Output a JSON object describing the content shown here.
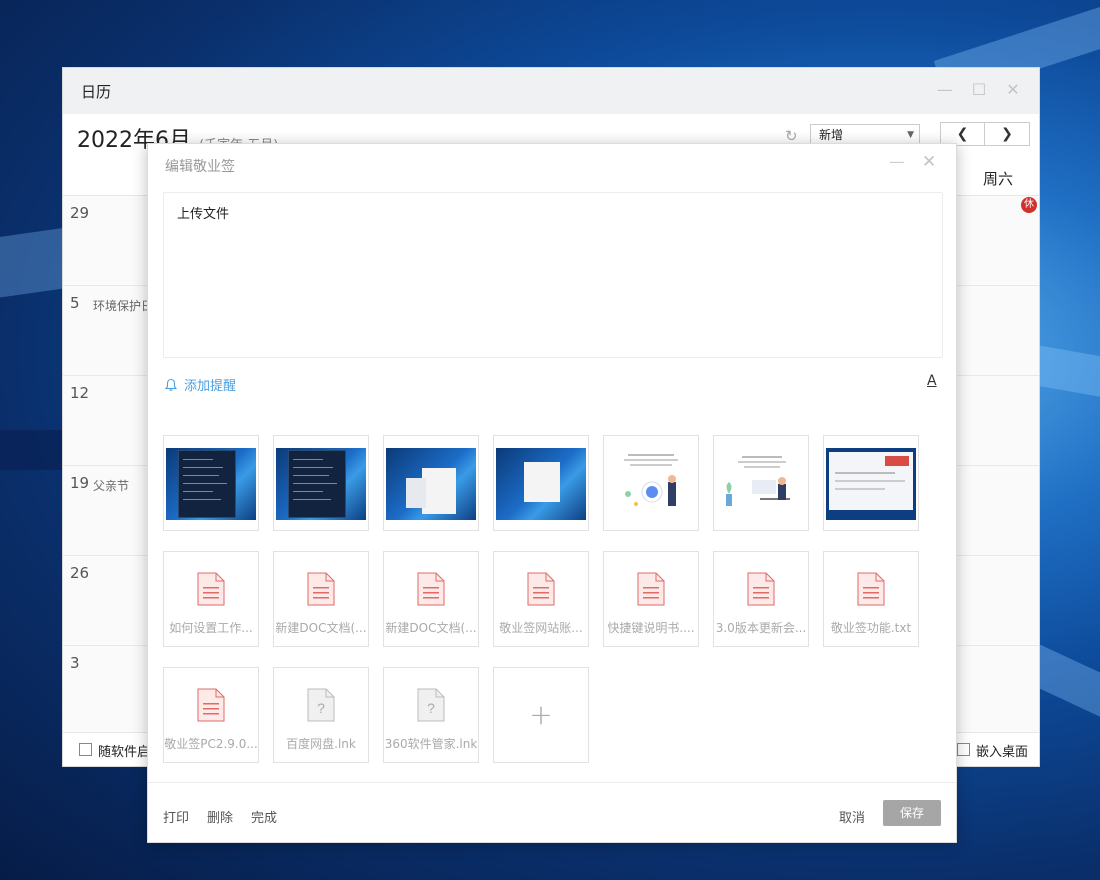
{
  "calendar_window": {
    "title": "日历",
    "month_title": "2022年6月",
    "lunar_subtitle": "(壬寅年 五月)",
    "new_select_value": "新增",
    "weekday_saturday": "周六",
    "rest_badge": "休",
    "rows": [
      {
        "date": "29",
        "event": ""
      },
      {
        "date": "5",
        "event": "环境保护日"
      },
      {
        "date": "12",
        "event": ""
      },
      {
        "date": "19",
        "event": "父亲节"
      },
      {
        "date": "26",
        "event": ""
      },
      {
        "date": "3",
        "event": ""
      }
    ],
    "footer_left_checkbox": "随软件启动",
    "footer_right_checkbox": "嵌入桌面"
  },
  "dialog": {
    "title": "编辑敬业签",
    "content": "上传文件",
    "add_reminder": "添加提醒",
    "attachments_images": [
      {
        "type": "screenshot-dark-panel"
      },
      {
        "type": "screenshot-dark-panel"
      },
      {
        "type": "screenshot-calendar"
      },
      {
        "type": "screenshot-popup"
      },
      {
        "type": "illustration-people"
      },
      {
        "type": "illustration-desk"
      },
      {
        "type": "screenshot-webpage"
      }
    ],
    "attachments_files": [
      {
        "name": "如何设置工作...",
        "kind": "doc"
      },
      {
        "name": "新建DOC文档(...",
        "kind": "doc"
      },
      {
        "name": "新建DOC文档(...",
        "kind": "doc"
      },
      {
        "name": "敬业签网站账...",
        "kind": "doc"
      },
      {
        "name": "快捷键说明书....",
        "kind": "doc"
      },
      {
        "name": "3.0版本更新会...",
        "kind": "doc"
      },
      {
        "name": "敬业签功能.txt",
        "kind": "doc"
      },
      {
        "name": "敬业签PC2.9.0...",
        "kind": "doc"
      },
      {
        "name": "百度网盘.lnk",
        "kind": "unknown"
      },
      {
        "name": "360软件管家.lnk",
        "kind": "unknown"
      }
    ],
    "footer": {
      "print": "打印",
      "delete": "删除",
      "complete": "完成",
      "cancel": "取消",
      "save": "保存"
    }
  },
  "colors": {
    "accent_blue": "#4a9fe0",
    "file_icon_red": "#e06b66",
    "save_button_gray": "#a6a6a6",
    "rest_badge_red": "#d0312d"
  }
}
